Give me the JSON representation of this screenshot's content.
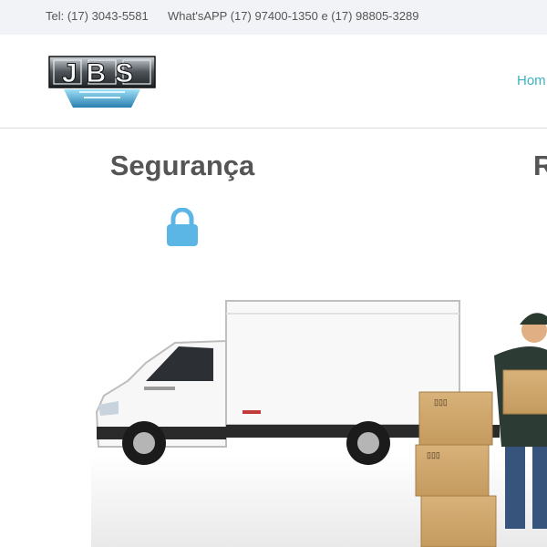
{
  "topbar": {
    "tel": "Tel: (17) 3043-5581",
    "whatsapp": "What'sAPP  (17) 97400-1350 e (17) 98805-3289"
  },
  "header": {
    "logo_text": "JBS",
    "nav": {
      "home_label": "Hom"
    }
  },
  "features": [
    {
      "title": "Segurança",
      "icon": "lock-icon"
    },
    {
      "title": "R"
    }
  ],
  "colors": {
    "topbar_bg": "#f1f3f6",
    "accent": "#3bb3c3",
    "lock": "#5bb6e6",
    "text": "#555555"
  }
}
